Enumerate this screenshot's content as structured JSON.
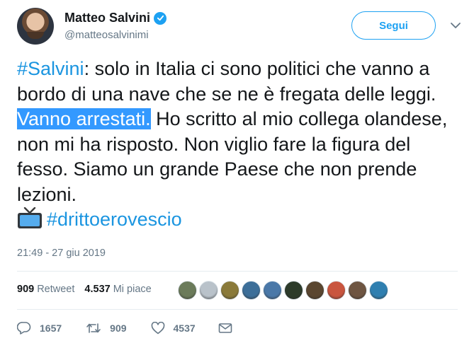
{
  "author": {
    "display_name": "Matteo Salvini",
    "handle": "@matteosalvinimi",
    "verified": true
  },
  "follow_button": {
    "label": "Segui"
  },
  "tweet": {
    "segments": [
      {
        "text": "#Salvini",
        "kind": "hashtag"
      },
      {
        "text": ": solo in Italia ci sono politici che vanno a bordo di una nave che se ne è fregata delle leggi. ",
        "kind": "text"
      },
      {
        "text": "Vanno arrestati.",
        "kind": "selected"
      },
      {
        "text": " Ho scritto al mio collega olandese, non mi ha risposto. Non viglio fare la figura del fesso. Siamo un grande Paese che non prende lezioni.",
        "kind": "text"
      }
    ],
    "emoji": "tv-icon",
    "final_hashtag": "#drittoerovescio",
    "timestamp": "21:49 - 27 giu 2019"
  },
  "stats": {
    "retweets_count": "909",
    "retweets_label": "Retweet",
    "likes_count": "4.537",
    "likes_label": "Mi piace",
    "liker_avatar_colors": [
      "#6b7b5a",
      "#b9c2ca",
      "#8a7a3a",
      "#3d6f99",
      "#4a78a8",
      "#2d3b2a",
      "#5a4630",
      "#c9553f",
      "#6e5542",
      "#2f7fb0"
    ]
  },
  "actions": {
    "reply_count": "1657",
    "retweet_count": "909",
    "like_count": "4537"
  },
  "colors": {
    "accent": "#1da1f2",
    "hashtag": "#1b95e0",
    "selection": "#3399ff",
    "muted": "#657786"
  }
}
